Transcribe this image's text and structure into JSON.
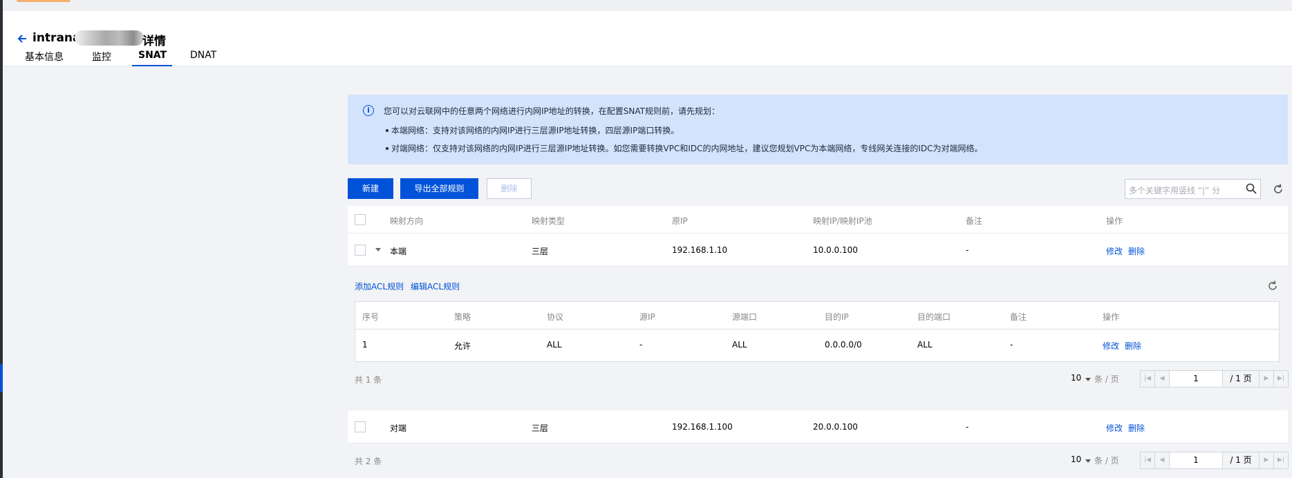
{
  "page": {
    "title_prefix": "intranat",
    "title_suffix": "详情"
  },
  "tabs": [
    {
      "label": "基本信息"
    },
    {
      "label": "监控"
    },
    {
      "label": "SNAT"
    },
    {
      "label": "DNAT"
    }
  ],
  "notice": {
    "intro": "您可以对云联网中的任意两个网络进行内网IP地址的转换，在配置SNAT规则前，请先规划：",
    "items": [
      "本端网络：支持对该网络的内网IP进行三层源IP地址转换，四层源IP端口转换。",
      "对端网络：仅支持对该网络的内网IP进行三层源IP地址转换。如您需要转换VPC和IDC的内网地址，建议您规划VPC为本端网络，专线网关连接的IDC为对端网络。"
    ]
  },
  "toolbar": {
    "new_label": "新建",
    "export_label": "导出全部规则",
    "delete_label": "删除",
    "search_placeholder": "多个关键字用竖线 “|” 分"
  },
  "table": {
    "headers": [
      "映射方向",
      "映射类型",
      "原IP",
      "映射IP/映射IP池",
      "备注",
      "操作"
    ],
    "rows": [
      {
        "direction": "本端",
        "type": "三层",
        "src_ip": "192.168.1.10",
        "map_ip": "10.0.0.100",
        "remark": "-",
        "edit": "修改",
        "delete": "删除"
      },
      {
        "direction": "对端",
        "type": "三层",
        "src_ip": "192.168.1.100",
        "map_ip": "20.0.0.100",
        "remark": "-",
        "edit": "修改",
        "delete": "删除"
      }
    ],
    "total": "共 2 条"
  },
  "acl": {
    "add_label": "添加ACL规则",
    "edit_label": "编辑ACL规则",
    "headers": [
      "序号",
      "策略",
      "协议",
      "源IP",
      "源端口",
      "目的IP",
      "目的端口",
      "备注",
      "操作"
    ],
    "rows": [
      {
        "no": "1",
        "policy": "允许",
        "protocol": "ALL",
        "src_ip": "-",
        "src_port": "ALL",
        "dst_ip": "0.0.0.0/0",
        "dst_port": "ALL",
        "remark": "-",
        "edit": "修改",
        "delete": "删除"
      }
    ],
    "total": "共 1 条"
  },
  "pagination": {
    "page_size": "10",
    "unit": "条 / 页",
    "current_page": "1",
    "total_pages": "/ 1 页"
  },
  "colors": {
    "primary": "#0052d9",
    "notice_bg": "#d4e3fc"
  }
}
